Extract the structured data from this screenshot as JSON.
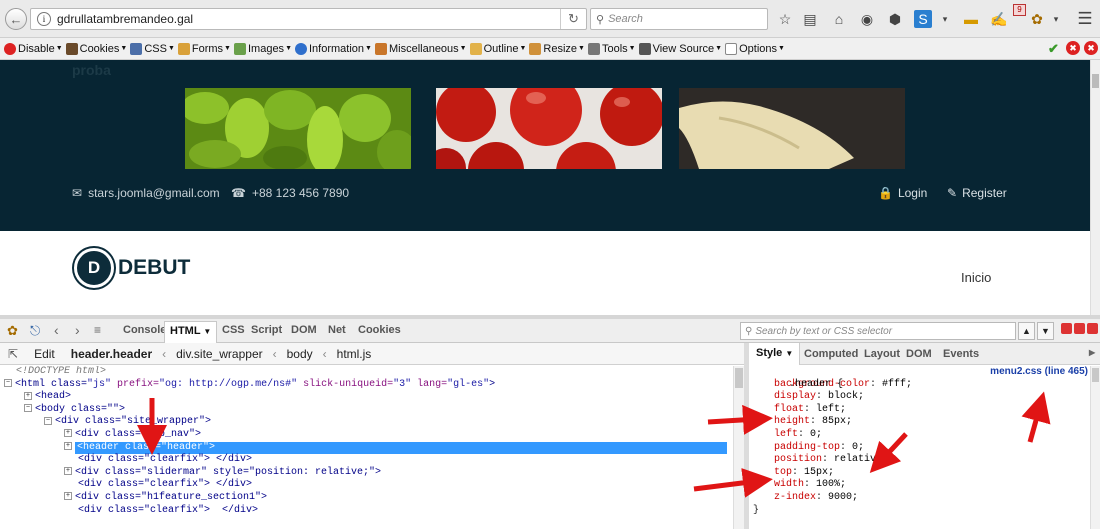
{
  "browser": {
    "url": "gdrullatambremandeo.gal",
    "search_placeholder": "Search",
    "badge_count": "9"
  },
  "webdev_toolbar": {
    "items": [
      "Disable",
      "Cookies",
      "CSS",
      "Forms",
      "Images",
      "Information",
      "Miscellaneous",
      "Outline",
      "Resize",
      "Tools",
      "View Source",
      "Options"
    ]
  },
  "page": {
    "proba": "proba",
    "email": "stars.joomla@gmail.com",
    "phone": "+88 123 456 7890",
    "login": "Login",
    "register": "Register",
    "logo_letter": "D",
    "logo_text": "DEBUT",
    "menu_item": "Inicio"
  },
  "firebug": {
    "tabs": [
      "Console",
      "HTML",
      "CSS",
      "Script",
      "DOM",
      "Net",
      "Cookies"
    ],
    "active_tab": "HTML",
    "search_placeholder": "Search by text or CSS selector",
    "edit_label": "Edit",
    "breadcrumbs": [
      "header.header",
      "div.site_wrapper",
      "body",
      "html.js"
    ],
    "side_tabs": [
      "Style",
      "Computed",
      "Layout",
      "DOM",
      "Events"
    ],
    "css_source": "menu2.css (line 465)",
    "css_selector": ".header {",
    "css_rules": [
      {
        "prop": "background-color",
        "value": "#fff;"
      },
      {
        "prop": "display",
        "value": "block;"
      },
      {
        "prop": "float",
        "value": "left;"
      },
      {
        "prop": "height",
        "value": "85px;"
      },
      {
        "prop": "left",
        "value": "0;"
      },
      {
        "prop": "padding-top",
        "value": "0;"
      },
      {
        "prop": "position",
        "value": "relative;"
      },
      {
        "prop": "top",
        "value": "15px;"
      },
      {
        "prop": "width",
        "value": "100%;"
      },
      {
        "prop": "z-index",
        "value": "9000;"
      }
    ],
    "css_close": "}",
    "html_lines": {
      "doctype": "<!DOCTYPE html>",
      "html_open_a": "<html class=",
      "html_open_b": "\"js\"",
      "html_open_c": " prefix=",
      "html_open_d": "\"og: http://ogp.me/ns#\"",
      "html_open_e": " slick-uniqueid=",
      "html_open_f": "\"3\"",
      "html_open_g": " lang=",
      "html_open_h": "\"gl-es\"",
      "html_open_i": ">",
      "head": "<head>",
      "body": "<body class=\"\">",
      "site_wrapper": "<div class=\"site_wrapper\">",
      "top_nav": "<div class=\"top_nav\">",
      "header": "<header class=\"header\">",
      "clearfix1": "<div class=\"clearfix\"> </div>",
      "slidermar": "<div class=\"slidermar\" style=\"position: relative;\">",
      "clearfix2": "<div class=\"clearfix\"> </div>",
      "h1feature": "<div class=\"h1feature_section1\">",
      "clearfix3": "<div class=\"clearfix\">  </div>"
    }
  },
  "colors": {
    "site_header_bg": "#072533",
    "selection": "#3399ff",
    "arrow_red": "#e01515"
  }
}
